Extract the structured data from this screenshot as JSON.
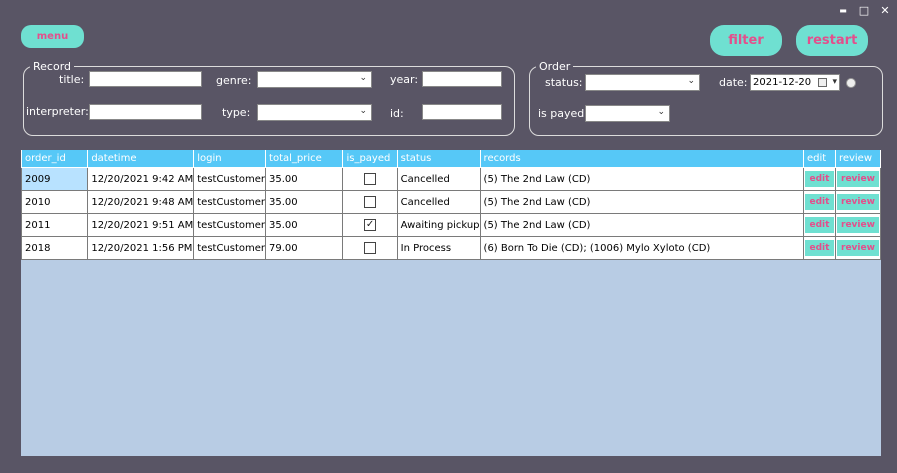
{
  "window": {
    "minimize_glyph": "▬",
    "maximize_glyph": "□",
    "close_glyph": "✕"
  },
  "toolbar": {
    "menu_label": "menu",
    "filter_label": "filter",
    "restart_label": "restart"
  },
  "record_group": {
    "legend": "Record",
    "title_label": "title:",
    "genre_label": "genre:",
    "year_label": "year:",
    "interpreter_label": "interpreter:",
    "type_label": "type:",
    "id_label": "id:",
    "title_value": "",
    "genre_value": "",
    "year_value": "",
    "interpreter_value": "",
    "type_value": "",
    "id_value": ""
  },
  "order_group": {
    "legend": "Order",
    "status_label": "status:",
    "date_label": "date:",
    "is_payed_label": "is payed:",
    "status_value": "",
    "date_value": "2021-12-20",
    "is_payed_value": ""
  },
  "grid": {
    "columns": [
      "order_id",
      "datetime",
      "login",
      "total_price",
      "is_payed",
      "status",
      "records",
      "edit",
      "review"
    ],
    "rows": [
      {
        "order_id": "2009",
        "datetime": "12/20/2021 9:42 AM",
        "login": "testCustomer",
        "total_price": "35.00",
        "is_payed": false,
        "status": "Cancelled",
        "records": "(5) The 2nd Law (CD)",
        "edit": "edit",
        "review": "review"
      },
      {
        "order_id": "2010",
        "datetime": "12/20/2021 9:48 AM",
        "login": "testCustomer",
        "total_price": "35.00",
        "is_payed": false,
        "status": "Cancelled",
        "records": "(5) The 2nd Law (CD)",
        "edit": "edit",
        "review": "review"
      },
      {
        "order_id": "2011",
        "datetime": "12/20/2021 9:51 AM",
        "login": "testCustomer",
        "total_price": "35.00",
        "is_payed": true,
        "status": "Awaiting pickup",
        "records": "(5) The 2nd Law (CD)",
        "edit": "edit",
        "review": "review"
      },
      {
        "order_id": "2018",
        "datetime": "12/20/2021 1:56 PM",
        "login": "testCustomer",
        "total_price": "79.00",
        "is_payed": false,
        "status": "In Process",
        "records": "(6) Born To Die (CD); (1006) Mylo Xyloto (CD)",
        "edit": "edit",
        "review": "review"
      }
    ]
  },
  "colors": {
    "background": "#595565",
    "accent_button": "#6fe0d1",
    "accent_text": "#e34f8c",
    "grid_header": "#56c8f7",
    "grid_empty": "#b8cce4",
    "selected_cell": "#b8e2ff"
  }
}
